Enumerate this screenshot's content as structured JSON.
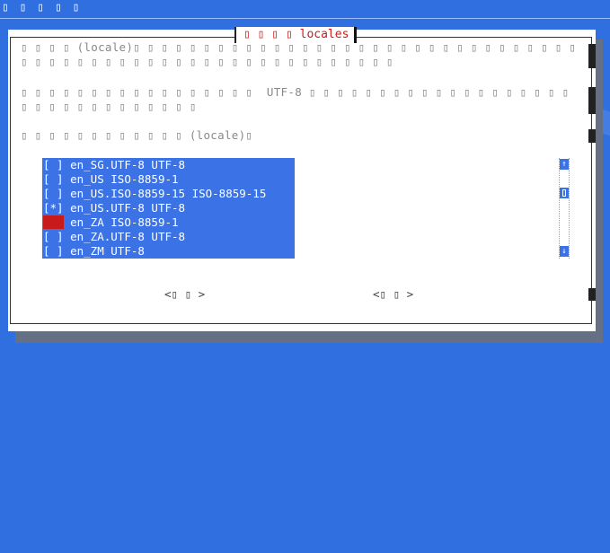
{
  "window": {
    "title": "▯ ▯ ▯ ▯ ▯"
  },
  "dialog": {
    "title": "▯ ▯ ▯ ▯  locales",
    "paragraph_1": "▯ ▯ ▯ ▯ (locale)▯ ▯ ▯ ▯ ▯ ▯ ▯ ▯ ▯ ▯ ▯ ▯ ▯ ▯ ▯ ▯ ▯ ▯ ▯ ▯ ▯ ▯ ▯ ▯ ▯ ▯ ▯ ▯ ▯ ▯ ▯ ▯ ▯ ▯ ▯ ▯ ▯ ▯ ▯ ▯ ▯ ▯ ▯ ▯ ▯ ▯ ▯ ▯ ▯ ▯ ▯ ▯ ▯ ▯ ▯ ▯ ▯ ▯ ▯",
    "paragraph_2": "▯ ▯ ▯ ▯ ▯ ▯ ▯ ▯ ▯ ▯ ▯ ▯ ▯ ▯ ▯ ▯ ▯  UTF-8 ▯ ▯ ▯ ▯ ▯ ▯ ▯ ▯ ▯ ▯ ▯ ▯ ▯ ▯ ▯ ▯ ▯ ▯ ▯ ▯ ▯ ▯ ▯ ▯ ▯ ▯ ▯ ▯ ▯ ▯ ▯ ▯",
    "paragraph_3": "▯ ▯ ▯ ▯ ▯ ▯ ▯ ▯ ▯ ▯ ▯ ▯ (locale)▯",
    "locale_list": [
      {
        "checkbox": "[ ]",
        "label": "en_SG.UTF-8 UTF-8",
        "checked": false
      },
      {
        "checkbox": "[ ]",
        "label": "en_US ISO-8859-1",
        "checked": false
      },
      {
        "checkbox": "[ ]",
        "label": "en_US.ISO-8859-15 ISO-8859-15",
        "checked": false
      },
      {
        "checkbox": "[*]",
        "label": "en_US.UTF-8 UTF-8",
        "checked": true
      },
      {
        "checkbox": "[ ]",
        "label": "en_ZA ISO-8859-1",
        "checked": false,
        "cursor": true
      },
      {
        "checkbox": "[ ]",
        "label": "en_ZA.UTF-8 UTF-8",
        "checked": false
      },
      {
        "checkbox": "[ ]",
        "label": "en_ZM UTF-8",
        "checked": false
      }
    ],
    "scroll_up_glyph": "↑",
    "scroll_down_glyph": "↓",
    "ok_button": "<▯ ▯ >",
    "cancel_button": "<▯ ▯ >"
  },
  "colors": {
    "desktop": "#2f6fe0",
    "selection": "#3b72e6",
    "title_text": "#d01818",
    "cursor": "#c81a1a"
  }
}
